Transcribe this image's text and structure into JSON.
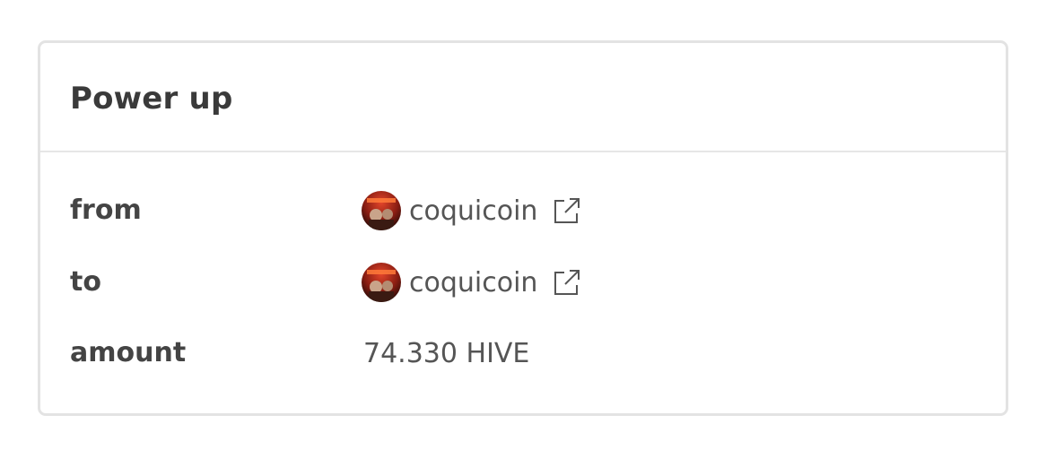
{
  "card": {
    "title": "Power up"
  },
  "rows": [
    {
      "label": "from",
      "user": "coquicoin",
      "avatar_icon": "user-avatar",
      "link_icon": "external-link-icon"
    },
    {
      "label": "to",
      "user": "coquicoin",
      "avatar_icon": "user-avatar",
      "link_icon": "external-link-icon"
    },
    {
      "label": "amount",
      "value": "74.330 HIVE"
    }
  ],
  "colors": {
    "title": "#3a3a3a",
    "label": "#444444",
    "value": "#555555",
    "border": "#e3e3e3"
  }
}
